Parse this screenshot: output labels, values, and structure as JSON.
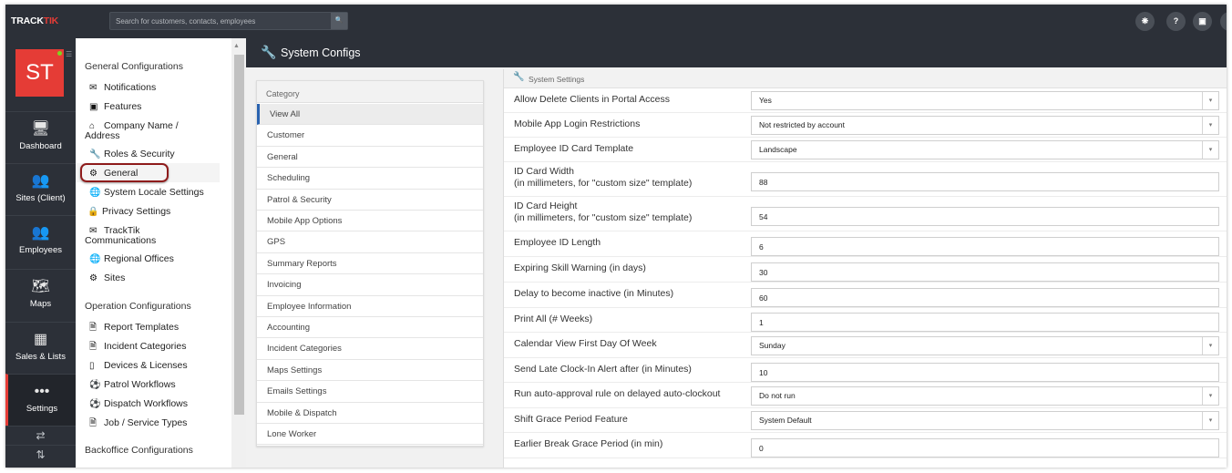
{
  "topbar": {
    "logo_track": "TRACK",
    "logo_tik": "TIK",
    "search_placeholder": "Search for customers, contacts, employees",
    "search_icon": "search-icon",
    "help_label": "?"
  },
  "leftnav": {
    "avatar_initials": "ST",
    "items": [
      {
        "label": "Dashboard",
        "icon": "monitor-icon"
      },
      {
        "label": "Sites (Client)",
        "icon": "group-icon"
      },
      {
        "label": "Employees",
        "icon": "group-icon"
      },
      {
        "label": "Maps",
        "icon": "map-icon"
      },
      {
        "label": "Sales & Lists",
        "icon": "bar-chart-icon"
      },
      {
        "label": "Settings",
        "icon": "more-dots-icon"
      }
    ]
  },
  "cfgmenu": {
    "general_title": "General Configurations",
    "general_items": [
      {
        "label": "Notifications",
        "icon": "envelope-icon"
      },
      {
        "label": "Features",
        "icon": "briefcase-icon"
      },
      {
        "label": "Company Name / Address",
        "icon": "home-icon"
      },
      {
        "label": "Roles & Security",
        "icon": "wrench-icon"
      },
      {
        "label": "General",
        "icon": "gear-icon"
      },
      {
        "label": "System Locale Settings",
        "icon": "globe-icon"
      },
      {
        "label": "Privacy Settings",
        "icon": "lock-icon"
      },
      {
        "label": "TrackTik Communications",
        "icon": "envelope-icon"
      },
      {
        "label": "Regional Offices",
        "icon": "globe-icon"
      },
      {
        "label": "Sites",
        "icon": "gear-icon"
      }
    ],
    "operation_title": "Operation Configurations",
    "operation_items": [
      {
        "label": "Report Templates",
        "icon": "file-icon"
      },
      {
        "label": "Incident Categories",
        "icon": "file-icon"
      },
      {
        "label": "Devices & Licenses",
        "icon": "mobile-icon"
      },
      {
        "label": "Patrol Workflows",
        "icon": "dribbble-icon"
      },
      {
        "label": "Dispatch Workflows",
        "icon": "dribbble-icon"
      },
      {
        "label": "Job / Service Types",
        "icon": "file-icon"
      }
    ],
    "backoffice_title": "Backoffice Configurations"
  },
  "page": {
    "title": "System Configs",
    "title_icon": "wrench-icon"
  },
  "category": {
    "header": "Category",
    "items": [
      "View All",
      "Customer",
      "General",
      "Scheduling",
      "Patrol & Security",
      "Mobile App Options",
      "GPS",
      "Summary Reports",
      "Invoicing",
      "Employee Information",
      "Accounting",
      "Incident Categories",
      "Maps Settings",
      "Emails Settings",
      "Mobile & Dispatch",
      "Lone Worker"
    ],
    "selected": "View All"
  },
  "settings": {
    "header": "System Settings",
    "rows": [
      {
        "label": "Allow Delete Clients in Portal Access",
        "sub": "",
        "type": "select",
        "value": "Yes"
      },
      {
        "label": "Mobile App Login Restrictions",
        "sub": "",
        "type": "select",
        "value": "Not restricted by account"
      },
      {
        "label": "Employee ID Card Template",
        "sub": "",
        "type": "select",
        "value": "Landscape"
      },
      {
        "label": "ID Card Width",
        "sub": "(in millimeters, for \"custom size\" template)",
        "type": "input",
        "value": "88"
      },
      {
        "label": "ID Card Height",
        "sub": "(in millimeters, for \"custom size\" template)",
        "type": "input",
        "value": "54"
      },
      {
        "label": "Employee ID Length",
        "sub": "",
        "type": "input",
        "value": "6"
      },
      {
        "label": "Expiring Skill Warning (in days)",
        "sub": "",
        "type": "input",
        "value": "30"
      },
      {
        "label": "Delay to become inactive (in Minutes)",
        "sub": "",
        "type": "input",
        "value": "60"
      },
      {
        "label": "Print All (# Weeks)",
        "sub": "",
        "type": "input",
        "value": "1"
      },
      {
        "label": "Calendar View First Day Of Week",
        "sub": "",
        "type": "select",
        "value": "Sunday"
      },
      {
        "label": "Send Late Clock-In Alert after (in Minutes)",
        "sub": "",
        "type": "input",
        "value": "10"
      },
      {
        "label": "Run auto-approval rule on delayed auto-clockout",
        "sub": "",
        "type": "select",
        "value": "Do not run"
      },
      {
        "label": "Shift Grace Period Feature",
        "sub": "",
        "type": "select",
        "value": "System Default"
      },
      {
        "label": "Earlier Break Grace Period (in min)",
        "sub": "",
        "type": "input",
        "value": "0"
      }
    ]
  }
}
